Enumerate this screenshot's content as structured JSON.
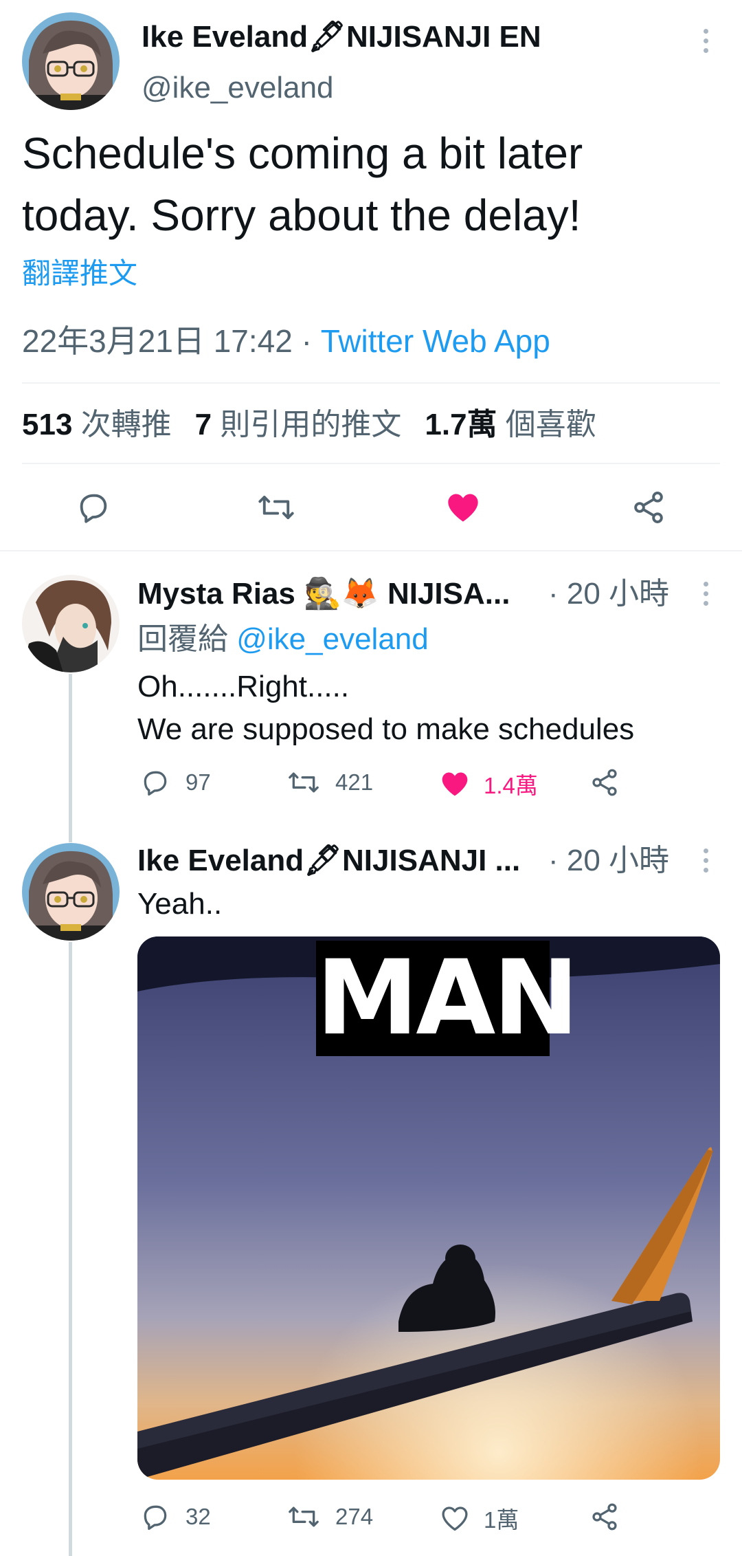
{
  "main_tweet": {
    "display_name": "Ike Eveland",
    "name_emoji": "🖋",
    "display_name_suffix": "NIJISANJI EN",
    "handle": "@ike_eveland",
    "text_line1": "Schedule's coming a bit later",
    "text_line2": "today. Sorry about the delay!",
    "translate_label": "翻譯推文",
    "timestamp": "22年3月21日 17:42",
    "separator": "·",
    "source": "Twitter Web App",
    "stats": {
      "retweets_count": "513",
      "retweets_label": "次轉推",
      "quotes_count": "7",
      "quotes_label": "則引用的推文",
      "likes_count": "1.7萬",
      "likes_label": "個喜歡"
    },
    "actions": {
      "reply_icon": "reply-icon",
      "retweet_icon": "retweet-icon",
      "like_icon": "heart-filled-icon",
      "share_icon": "share-icon",
      "like_color": "#f91880"
    }
  },
  "replies": [
    {
      "display_name": "Mysta Rias",
      "name_emoji": "🕵🦊",
      "display_name_suffix": "NIJISA...",
      "time": "· 20 小時",
      "reply_to_label": "回覆給",
      "reply_to_handle": "@ike_eveland",
      "text_line1": "Oh.......Right.....",
      "text_line2": "We are supposed to make schedules",
      "reply_count": "97",
      "retweet_count": "421",
      "like_count": "1.4萬",
      "liked": true
    },
    {
      "display_name": "Ike Eveland",
      "name_emoji": "🖋",
      "display_name_suffix": "NIJISANJI ...",
      "time": "· 20 小時",
      "text_line1": "Yeah..",
      "image_caption": "MAN",
      "reply_count": "32",
      "retweet_count": "274",
      "like_count": "1萬",
      "liked": false
    }
  ],
  "colors": {
    "accent": "#1d9bf0",
    "like": "#f91880",
    "muted": "#536471",
    "thread_line": "#cfd9de"
  }
}
